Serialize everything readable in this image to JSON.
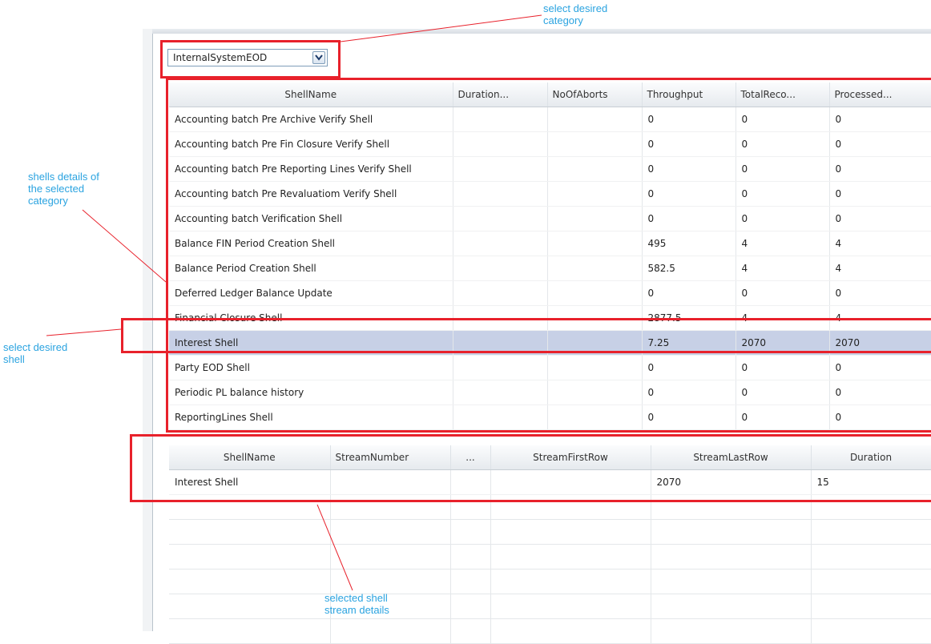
{
  "category_select": {
    "value": "InternalSystemEOD",
    "arrow_icon": "chevron-down-icon"
  },
  "shells_table": {
    "columns": [
      "ShellName",
      "Duration...",
      "NoOfAborts",
      "Throughput",
      "TotalReco...",
      "Processed..."
    ],
    "rows": [
      [
        "Accounting batch Pre Archive Verify Shell",
        "",
        "",
        "0",
        "0",
        "0"
      ],
      [
        "Accounting batch Pre Fin Closure Verify Shell",
        "",
        "",
        "0",
        "0",
        "0"
      ],
      [
        "Accounting batch Pre Reporting Lines Verify Shell",
        "",
        "",
        "0",
        "0",
        "0"
      ],
      [
        "Accounting batch Pre Revaluatiom Verify Shell",
        "",
        "",
        "0",
        "0",
        "0"
      ],
      [
        "Accounting batch Verification Shell",
        "",
        "",
        "0",
        "0",
        "0"
      ],
      [
        "Balance FIN Period Creation Shell",
        "",
        "",
        "495",
        "4",
        "4"
      ],
      [
        "Balance Period Creation Shell",
        "",
        "",
        "582.5",
        "4",
        "4"
      ],
      [
        "Deferred Ledger Balance Update",
        "",
        "",
        "0",
        "0",
        "0"
      ],
      [
        "Financial Closure Shell",
        "",
        "",
        "2877.5",
        "4",
        "4"
      ],
      [
        "Interest Shell",
        "",
        "",
        "7.25",
        "2070",
        "2070"
      ],
      [
        "Party EOD Shell",
        "",
        "",
        "0",
        "0",
        "0"
      ],
      [
        "Periodic PL balance history",
        "",
        "",
        "0",
        "0",
        "0"
      ],
      [
        "ReportingLines Shell",
        "",
        "",
        "0",
        "0",
        "0"
      ]
    ],
    "selected_row": 9
  },
  "streams_table": {
    "columns": [
      "ShellName",
      "StreamNumber",
      "...",
      "StreamFirstRow",
      "StreamLastRow",
      "Duration"
    ],
    "rows": [
      [
        "Interest Shell",
        "",
        "",
        "",
        "2070",
        "15"
      ]
    ],
    "empty_rows": 6
  },
  "annotations": {
    "category": "select desired category",
    "shells": "shells details of the selected category",
    "shell": "select desired shell",
    "stream": "selected shell stream details"
  },
  "colors": {
    "highlight": "#e8212b",
    "annotation": "#2aa3e0",
    "selected_row": "#c7d0e6"
  }
}
